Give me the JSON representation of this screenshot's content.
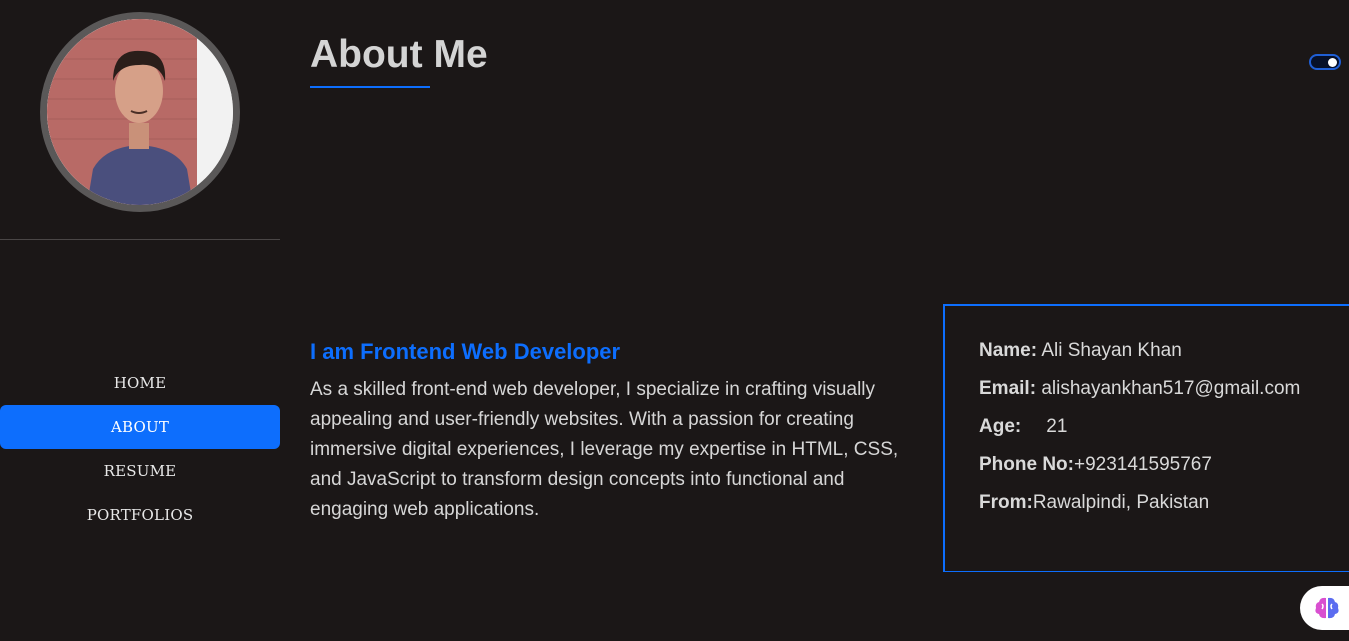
{
  "nav": {
    "items": [
      {
        "label": "HOME"
      },
      {
        "label": "ABOUT",
        "active": true
      },
      {
        "label": "RESUME"
      },
      {
        "label": "PORTFOLIOS"
      }
    ]
  },
  "header": {
    "title": "About Me"
  },
  "intro": {
    "heading": "I am Frontend Web Developer",
    "text": "As a skilled front-end web developer, I specialize in crafting visually appealing and user-friendly websites. With a passion for creating immersive digital experiences, I leverage my expertise in HTML, CSS, and JavaScript to transform design concepts into functional and engaging web applications."
  },
  "info": {
    "name_label": "Name:",
    "name_value": "Ali Shayan Khan",
    "email_label": "Email:",
    "email_value": "alishayankhan517@gmail.com",
    "age_label": "Age:",
    "age_value": "21",
    "phone_label": "Phone No:",
    "phone_value": "+923141595767",
    "from_label": "From:",
    "from_value": "Rawalpindi, Pakistan"
  },
  "colors": {
    "background": "#1b1717",
    "accent": "#0d6efd",
    "text": "#d9d9d9"
  },
  "icons": {
    "avatar": "profile-photo",
    "theme_toggle": "toggle-switch",
    "extension": "brain-icon"
  }
}
